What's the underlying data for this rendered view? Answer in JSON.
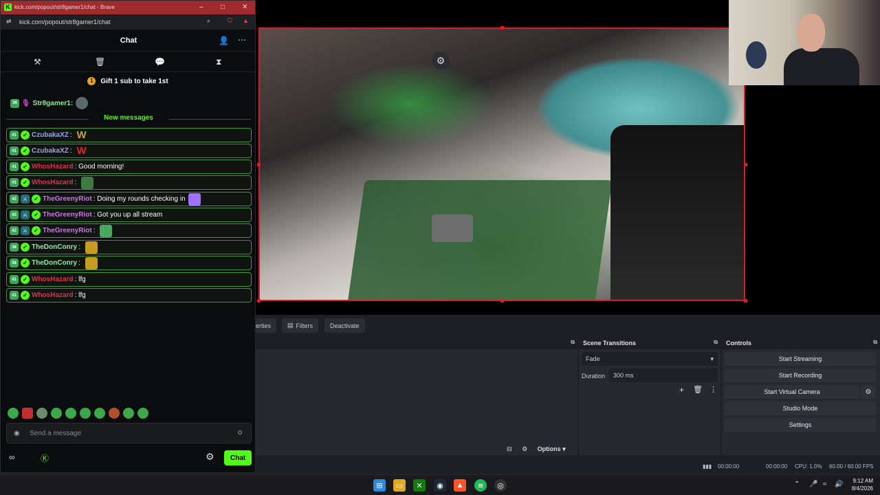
{
  "browser": {
    "title": "kick.com/popout/str8gamer1/chat - Brave",
    "url": "kick.com/popout/str8gamer1/chat"
  },
  "chat": {
    "title": "Chat",
    "pinned": "Gift 1 sub to take 1st",
    "pinned_rank": "1",
    "top_user": {
      "badge": "36",
      "name": "Str8gamer1:"
    },
    "new_messages_label": "New messages",
    "messages": [
      {
        "badge": "41",
        "name": "CzubakaXZ",
        "color": "#9ca0e8",
        "text": "",
        "emote": "W",
        "emote_color": "#c8a040"
      },
      {
        "badge": "41",
        "name": "CzubakaXZ",
        "color": "#9ca0e8",
        "text": "",
        "emote": "W",
        "emote_color": "#e02020"
      },
      {
        "badge": "41",
        "name": "WhosHazard",
        "color": "#e0304a",
        "text": "Good morning!",
        "emote": ""
      },
      {
        "badge": "41",
        "name": "WhosHazard",
        "color": "#e0304a",
        "text": "",
        "emote": "pepe",
        "emote_color": "#3d7a3d"
      },
      {
        "badge": "42",
        "name": "TheGreenyRiot",
        "color": "#d070e8",
        "text": "Doing my rounds checking in",
        "emote": "mix",
        "emote_color": "#a070ff"
      },
      {
        "badge": "42",
        "name": "TheGreenyRiot",
        "color": "#d070e8",
        "text": "Got you up all stream",
        "emote": ""
      },
      {
        "badge": "42",
        "name": "TheGreenyRiot",
        "color": "#d070e8",
        "text": "",
        "emote": "frog",
        "emote_color": "#4aa860"
      },
      {
        "badge": "38",
        "name": "TheDonConry",
        "color": "#8fe7a2",
        "text": "",
        "emote": "gold",
        "emote_color": "#c89a20"
      },
      {
        "badge": "38",
        "name": "TheDonConry",
        "color": "#8fe7a2",
        "text": "",
        "emote": "gold",
        "emote_color": "#c89a20"
      },
      {
        "badge": "41",
        "name": "WhosHazard",
        "color": "#e0304a",
        "text": "lfg",
        "emote": ""
      },
      {
        "badge": "41",
        "name": "WhosHazard",
        "color": "#e0304a",
        "text": "lfg",
        "emote": ""
      }
    ],
    "input_placeholder": "Send a message",
    "send_label": "Chat"
  },
  "obs": {
    "prop_buttons": {
      "properties": "erties",
      "filters": "Filters",
      "deactivate": "Deactivate"
    },
    "scene_transitions": {
      "title": "Scene Transitions",
      "transition": "Fade",
      "duration_label": "Duration",
      "duration": "300 ms"
    },
    "controls": {
      "title": "Controls",
      "buttons": [
        "Start Streaming",
        "Start Recording",
        "Start Virtual Camera",
        "Studio Mode",
        "Settings"
      ]
    },
    "options_label": "Options",
    "status": {
      "rec_time1": "00:00:00",
      "rec_time2": "00:00:00",
      "cpu": "CPU: 1.0%",
      "fps": "60.00 / 60.00 FPS"
    }
  },
  "taskbar": {
    "time": "9:12 AM",
    "date": "8/4/2026"
  }
}
